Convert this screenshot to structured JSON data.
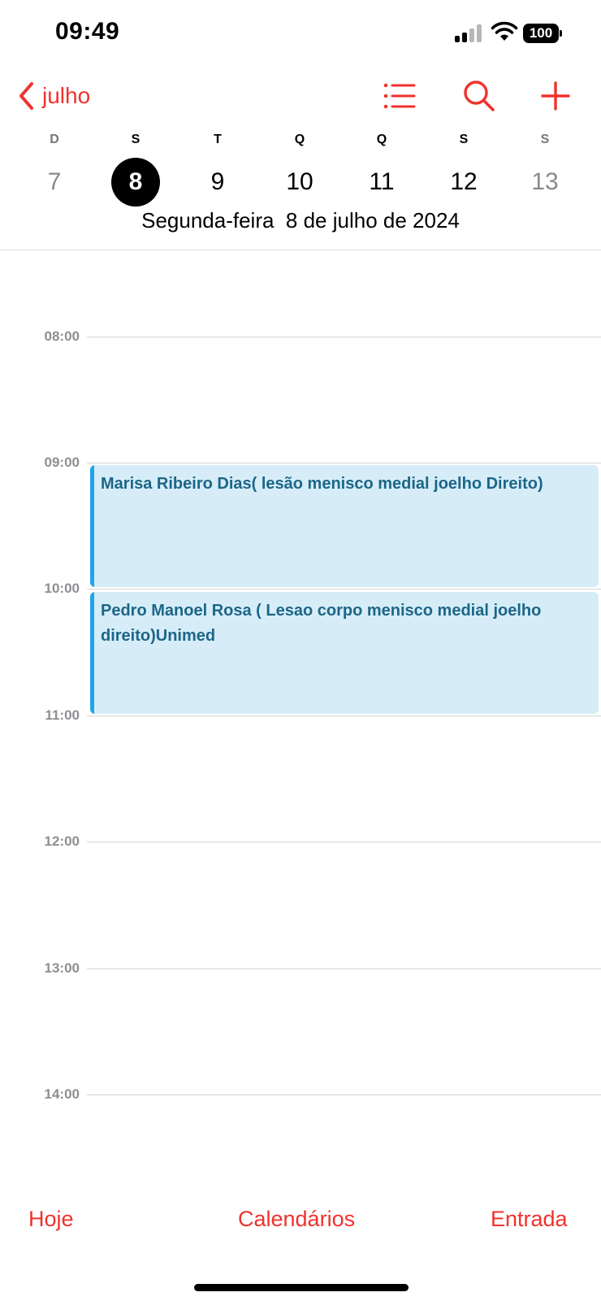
{
  "status_bar": {
    "time": "09:49",
    "battery": "100",
    "icons": [
      "signal-icon",
      "wifi-icon",
      "battery-icon"
    ]
  },
  "nav": {
    "back_label": "julho",
    "icons": [
      "chevron-left-icon",
      "list-icon",
      "search-icon",
      "plus-icon"
    ]
  },
  "week": {
    "days": [
      {
        "letter": "D",
        "number": "7",
        "state": "muted"
      },
      {
        "letter": "S",
        "number": "8",
        "state": "selected"
      },
      {
        "letter": "T",
        "number": "9",
        "state": "normal"
      },
      {
        "letter": "Q",
        "number": "10",
        "state": "normal"
      },
      {
        "letter": "Q",
        "number": "11",
        "state": "normal"
      },
      {
        "letter": "S",
        "number": "12",
        "state": "normal"
      },
      {
        "letter": "S",
        "number": "13",
        "state": "muted"
      }
    ],
    "date_title": "Segunda-feira  8 de julho de 2024"
  },
  "timeline": {
    "hours": [
      "08:00",
      "09:00",
      "10:00",
      "11:00",
      "12:00",
      "13:00",
      "14:00"
    ],
    "events": [
      {
        "title": "Marisa Ribeiro Dias( lesão menisco medial joelho Direito)",
        "start": "09:00",
        "end": "10:00"
      },
      {
        "title": "Pedro Manoel Rosa ( Lesao corpo menisco medial joelho direito)Unimed",
        "start": "10:00",
        "end": "11:00"
      }
    ]
  },
  "toolbar": {
    "today": "Hoje",
    "calendars": "Calendários",
    "inbox": "Entrada"
  },
  "colors": {
    "accent": "#f0322d",
    "event_background": "#d6edf8",
    "event_bar": "#1ea6e8",
    "event_text": "#1d6688",
    "selected_day": "#000000"
  }
}
